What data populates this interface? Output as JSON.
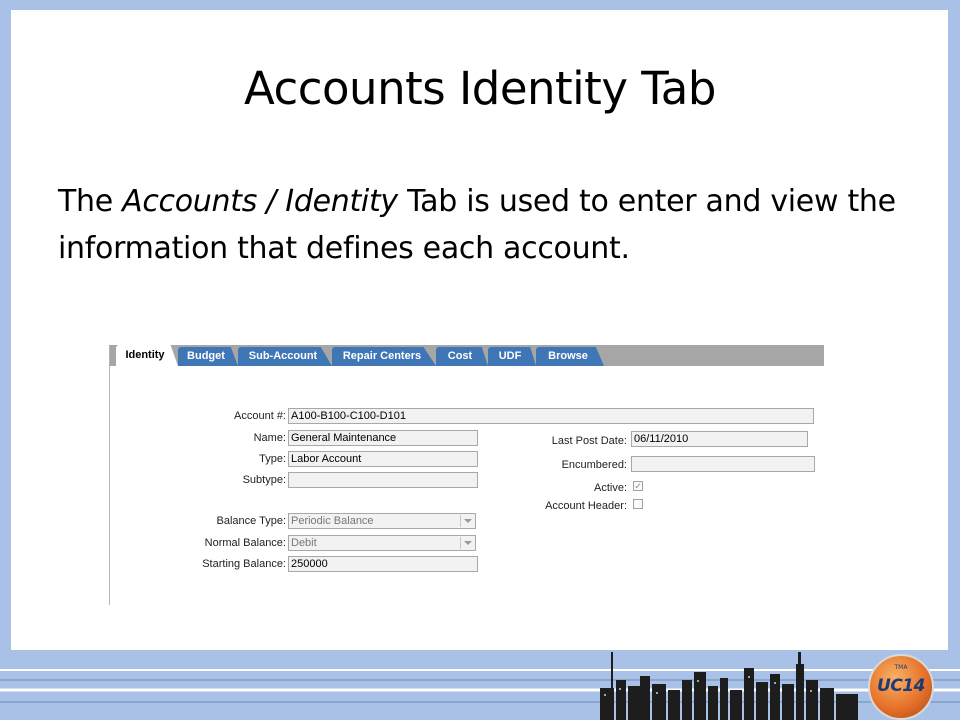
{
  "slide": {
    "title": "Accounts Identity Tab",
    "body_before": "The ",
    "body_italic": "Accounts / Identity",
    "body_after": " Tab is used to enter and view the information that defines each account."
  },
  "tabs": [
    "Identity",
    "Budget",
    "Sub-Account",
    "Repair Centers",
    "Cost",
    "UDF",
    "Browse"
  ],
  "form": {
    "account_label": "Account #:",
    "account_value": "A100-B100-C100-D101",
    "name_label": "Name:",
    "name_value": "General Maintenance",
    "type_label": "Type:",
    "type_value": "Labor Account",
    "subtype_label": "Subtype:",
    "subtype_value": "",
    "balance_type_label": "Balance Type:",
    "balance_type_value": "Periodic Balance",
    "normal_balance_label": "Normal Balance:",
    "normal_balance_value": "Debit",
    "starting_balance_label": "Starting Balance:",
    "starting_balance_value": "250000",
    "last_post_label": "Last Post Date:",
    "last_post_value": "06/11/2010",
    "encumbered_label": "Encumbered:",
    "encumbered_value": "",
    "active_label": "Active:",
    "active_checked": true,
    "account_header_label": "Account Header:",
    "account_header_checked": false
  },
  "logo": {
    "top_text": "TMA",
    "main_text": "UC14"
  },
  "colors": {
    "background": "#a9c1e6",
    "tab_blue": "#3f76b6",
    "tabbar_gray": "#a6a6a6",
    "logo_orange": "#e7722a"
  }
}
